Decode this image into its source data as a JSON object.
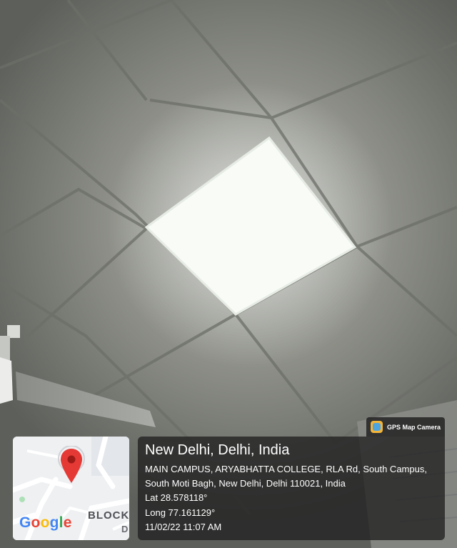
{
  "overlay": {
    "badge_label": "GPS Map Camera",
    "title": "New Delhi, Delhi, India",
    "address": "MAIN CAMPUS, ARYABHATTA COLLEGE, RLA Rd, South Campus, South Moti Bagh, New Delhi, Delhi 110021, India",
    "latitude": "Lat 28.578118°",
    "longitude": "Long 77.161129°",
    "datetime": "11/02/22 11:07 AM"
  },
  "map": {
    "logo_letters": [
      {
        "char": "G",
        "color": "#4285F4"
      },
      {
        "char": "o",
        "color": "#EA4335"
      },
      {
        "char": "o",
        "color": "#FBBC05"
      },
      {
        "char": "g",
        "color": "#4285F4"
      },
      {
        "char": "l",
        "color": "#34A853"
      },
      {
        "char": "e",
        "color": "#EA4335"
      }
    ],
    "label_main": "BLOCK",
    "label_second": "D",
    "pin_color": "#E53935"
  }
}
